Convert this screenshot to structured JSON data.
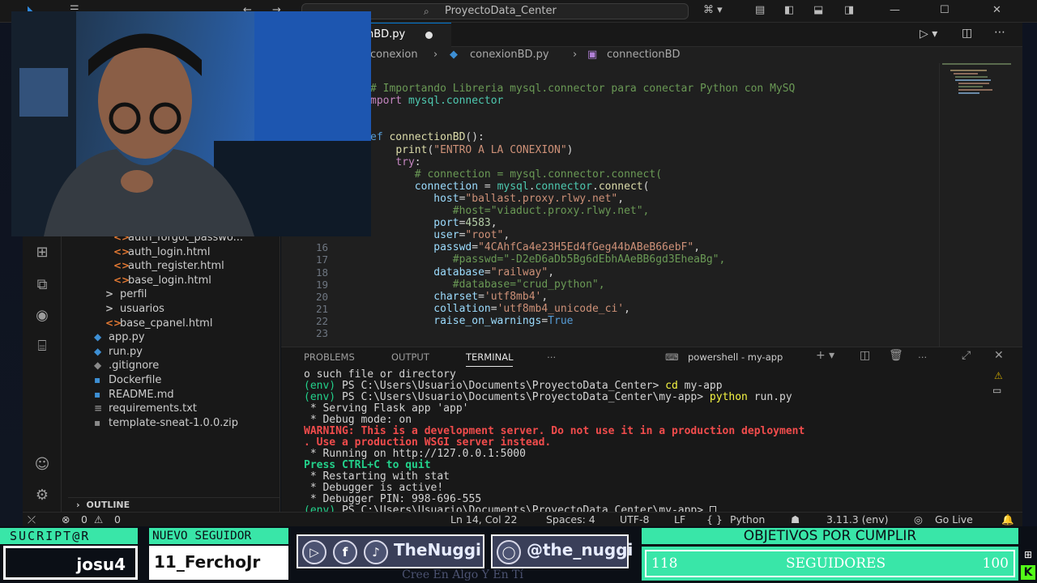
{
  "window": {
    "search_text": "ProyectoData_Center"
  },
  "editor": {
    "tab_label": "nBD.py",
    "breadcrumb": [
      "conexion",
      "conexionBD.py",
      "connectionBD"
    ],
    "lines": [
      {
        "num": "",
        "tokens": [
          [
            "c",
            "# Importando Libreria mysql.connector para conectar Python con MySQ"
          ]
        ]
      },
      {
        "num": "",
        "tokens": [
          [
            "k",
            "mport "
          ],
          [
            "m",
            "mysql.connector"
          ]
        ]
      },
      {
        "num": "",
        "tokens": []
      },
      {
        "num": "",
        "tokens": []
      },
      {
        "num": "",
        "tokens": [
          [
            "kw",
            "ef "
          ],
          [
            "f",
            "connectionBD"
          ],
          [
            "d",
            "():"
          ]
        ]
      },
      {
        "num": "",
        "tokens": [
          [
            "d",
            "    "
          ],
          [
            "f",
            "print"
          ],
          [
            "d",
            "("
          ],
          [
            "s",
            "\"ENTRO A LA CONEXION\""
          ],
          [
            "d",
            ")"
          ]
        ]
      },
      {
        "num": "",
        "tokens": [
          [
            "d",
            "    "
          ],
          [
            "k",
            "try"
          ],
          [
            "d",
            ":"
          ]
        ]
      },
      {
        "num": "",
        "tokens": [
          [
            "d",
            "       "
          ],
          [
            "c",
            "# connection = mysql.connector.connect("
          ]
        ]
      },
      {
        "num": "",
        "tokens": [
          [
            "d",
            "       "
          ],
          [
            "v",
            "connection"
          ],
          [
            "d",
            " = "
          ],
          [
            "m",
            "mysql"
          ],
          [
            "d",
            "."
          ],
          [
            "m",
            "connector"
          ],
          [
            "d",
            "."
          ],
          [
            "f",
            "connect"
          ],
          [
            "d",
            "("
          ]
        ]
      },
      {
        "num": "",
        "tokens": [
          [
            "d",
            "          "
          ],
          [
            "v",
            "host"
          ],
          [
            "d",
            "="
          ],
          [
            "s",
            "\"ballast.proxy.rlwy.net\""
          ],
          [
            "d",
            ","
          ]
        ]
      },
      {
        "num": "",
        "tokens": [
          [
            "d",
            "             "
          ],
          [
            "c",
            "#host=\"viaduct.proxy.rlwy.net\","
          ]
        ]
      },
      {
        "num": "",
        "tokens": [
          [
            "d",
            "          "
          ],
          [
            "v",
            "port"
          ],
          [
            "d",
            "="
          ],
          [
            "n",
            "4583"
          ],
          [
            "d",
            ","
          ]
        ]
      },
      {
        "num": "",
        "tokens": [
          [
            "d",
            "          "
          ],
          [
            "v",
            "user"
          ],
          [
            "d",
            "="
          ],
          [
            "s",
            "\"root\""
          ],
          [
            "d",
            ","
          ]
        ]
      },
      {
        "num": "16",
        "tokens": [
          [
            "d",
            "          "
          ],
          [
            "v",
            "passwd"
          ],
          [
            "d",
            "="
          ],
          [
            "s",
            "\"4CAhfCa4e23H5Ed4fGeg44bABeB66ebF\""
          ],
          [
            "d",
            ","
          ]
        ]
      },
      {
        "num": "17",
        "tokens": [
          [
            "d",
            "             "
          ],
          [
            "c",
            "#passwd=\"-D2eD6aDb5Bg6dEbhAAeBB6gd3EheaBg\","
          ]
        ]
      },
      {
        "num": "18",
        "tokens": [
          [
            "d",
            "          "
          ],
          [
            "v",
            "database"
          ],
          [
            "d",
            "="
          ],
          [
            "s",
            "\"railway\""
          ],
          [
            "d",
            ","
          ]
        ]
      },
      {
        "num": "19",
        "tokens": [
          [
            "d",
            "             "
          ],
          [
            "c",
            "#database=\"crud_python\","
          ]
        ]
      },
      {
        "num": "20",
        "tokens": [
          [
            "d",
            "          "
          ],
          [
            "v",
            "charset"
          ],
          [
            "d",
            "="
          ],
          [
            "s",
            "'utf8mb4'"
          ],
          [
            "d",
            ","
          ]
        ]
      },
      {
        "num": "21",
        "tokens": [
          [
            "d",
            "          "
          ],
          [
            "v",
            "collation"
          ],
          [
            "d",
            "="
          ],
          [
            "s",
            "'utf8mb4_unicode_ci'"
          ],
          [
            "d",
            ","
          ]
        ]
      },
      {
        "num": "22",
        "tokens": [
          [
            "d",
            "          "
          ],
          [
            "v",
            "raise_on_warnings"
          ],
          [
            "d",
            "="
          ],
          [
            "kw",
            "True"
          ]
        ]
      },
      {
        "num": "23",
        "tokens": []
      }
    ]
  },
  "explorer": {
    "items": [
      {
        "label": "auth_forgot_passwo...",
        "icon": "<>",
        "kind": "html",
        "indent": 2
      },
      {
        "label": "auth_login.html",
        "icon": "<>",
        "kind": "html",
        "indent": 2
      },
      {
        "label": "auth_register.html",
        "icon": "<>",
        "kind": "html",
        "indent": 2
      },
      {
        "label": "base_login.html",
        "icon": "<>",
        "kind": "html",
        "indent": 2
      },
      {
        "label": "perfil",
        "icon": ">",
        "kind": "folder",
        "indent": 1
      },
      {
        "label": "usuarios",
        "icon": ">",
        "kind": "folder",
        "indent": 1
      },
      {
        "label": "base_cpanel.html",
        "icon": "<>",
        "kind": "html",
        "indent": 1
      },
      {
        "label": "app.py",
        "icon": "◆",
        "kind": "py",
        "indent": 0
      },
      {
        "label": "run.py",
        "icon": "◆",
        "kind": "py",
        "indent": 0
      },
      {
        "label": ".gitignore",
        "icon": "◆",
        "kind": "dim",
        "indent": 0
      },
      {
        "label": "Dockerfile",
        "icon": "▪",
        "kind": "py",
        "indent": 0
      },
      {
        "label": "README.md",
        "icon": "▪",
        "kind": "py",
        "indent": 0
      },
      {
        "label": "requirements.txt",
        "icon": "≡",
        "kind": "dim",
        "indent": 0
      },
      {
        "label": "template-sneat-1.0.0.zip",
        "icon": "▪",
        "kind": "dim",
        "indent": 0
      }
    ],
    "outline_label": "OUTLINE"
  },
  "panel": {
    "tabs": [
      "PROBLEMS",
      "OUTPUT",
      "TERMINAL"
    ],
    "shell_label": "powershell - my-app",
    "terminal_lines": [
      [
        [
          "d",
          "o such file or directory"
        ]
      ],
      [
        [
          "g",
          "(env) "
        ],
        [
          "d",
          "PS C:\\Users\\Usuario\\Documents\\ProyectoData_Center> "
        ],
        [
          "y",
          "cd "
        ],
        [
          "d",
          "my-app"
        ]
      ],
      [
        [
          "g",
          "(env) "
        ],
        [
          "d",
          "PS C:\\Users\\Usuario\\Documents\\ProyectoData_Center\\my-app> "
        ],
        [
          "y",
          "python "
        ],
        [
          "d",
          "run.py"
        ]
      ],
      [
        [
          "d",
          " * Serving Flask app 'app'"
        ]
      ],
      [
        [
          "d",
          " * Debug mode: on"
        ]
      ],
      [
        [
          "r",
          "WARNING: This is a development server. Do not use it in a production deployment"
        ]
      ],
      [
        [
          "r",
          ". Use a production WSGI server instead."
        ]
      ],
      [
        [
          "d",
          " * Running on http://127.0.0.1:5000"
        ]
      ],
      [
        [
          "gb",
          "Press CTRL+C to quit"
        ]
      ],
      [
        [
          "d",
          " * Restarting with stat"
        ]
      ],
      [
        [
          "d",
          " * Debugger is active!"
        ]
      ],
      [
        [
          "d",
          " * Debugger PIN: 998-696-555"
        ]
      ],
      [
        [
          "g",
          "(env) "
        ],
        [
          "d",
          "PS C:\\Users\\Usuario\\Documents\\ProyectoData_Center\\my-app> "
        ]
      ]
    ]
  },
  "statusbar": {
    "errors": "0",
    "warnings": "0",
    "position": "Ln 14, Col 22",
    "spaces": "Spaces: 4",
    "encoding": "UTF-8",
    "eol": "LF",
    "language": "Python",
    "interpreter": "3.11.3 (env)",
    "golive": "Go Live"
  },
  "overlay": {
    "subscriber_label": "SUCRIPT@R",
    "subscriber_name": "josu4",
    "follower_label": "NUEVO SEGUIDOR",
    "follower_name": "11_FerchoJr",
    "social_name_1": "TheNuggi",
    "social_name_2": "@the_nuggi",
    "tagline": "Cree En Algo Y En Tí",
    "goals_label": "OBJETIVOS POR CUMPLIR",
    "goal_current": "118",
    "goal_label": "SEGUIDORES",
    "goal_target": "100"
  },
  "colors": {
    "accent": "#0078d4",
    "overlay_green": "#39e6a8"
  }
}
